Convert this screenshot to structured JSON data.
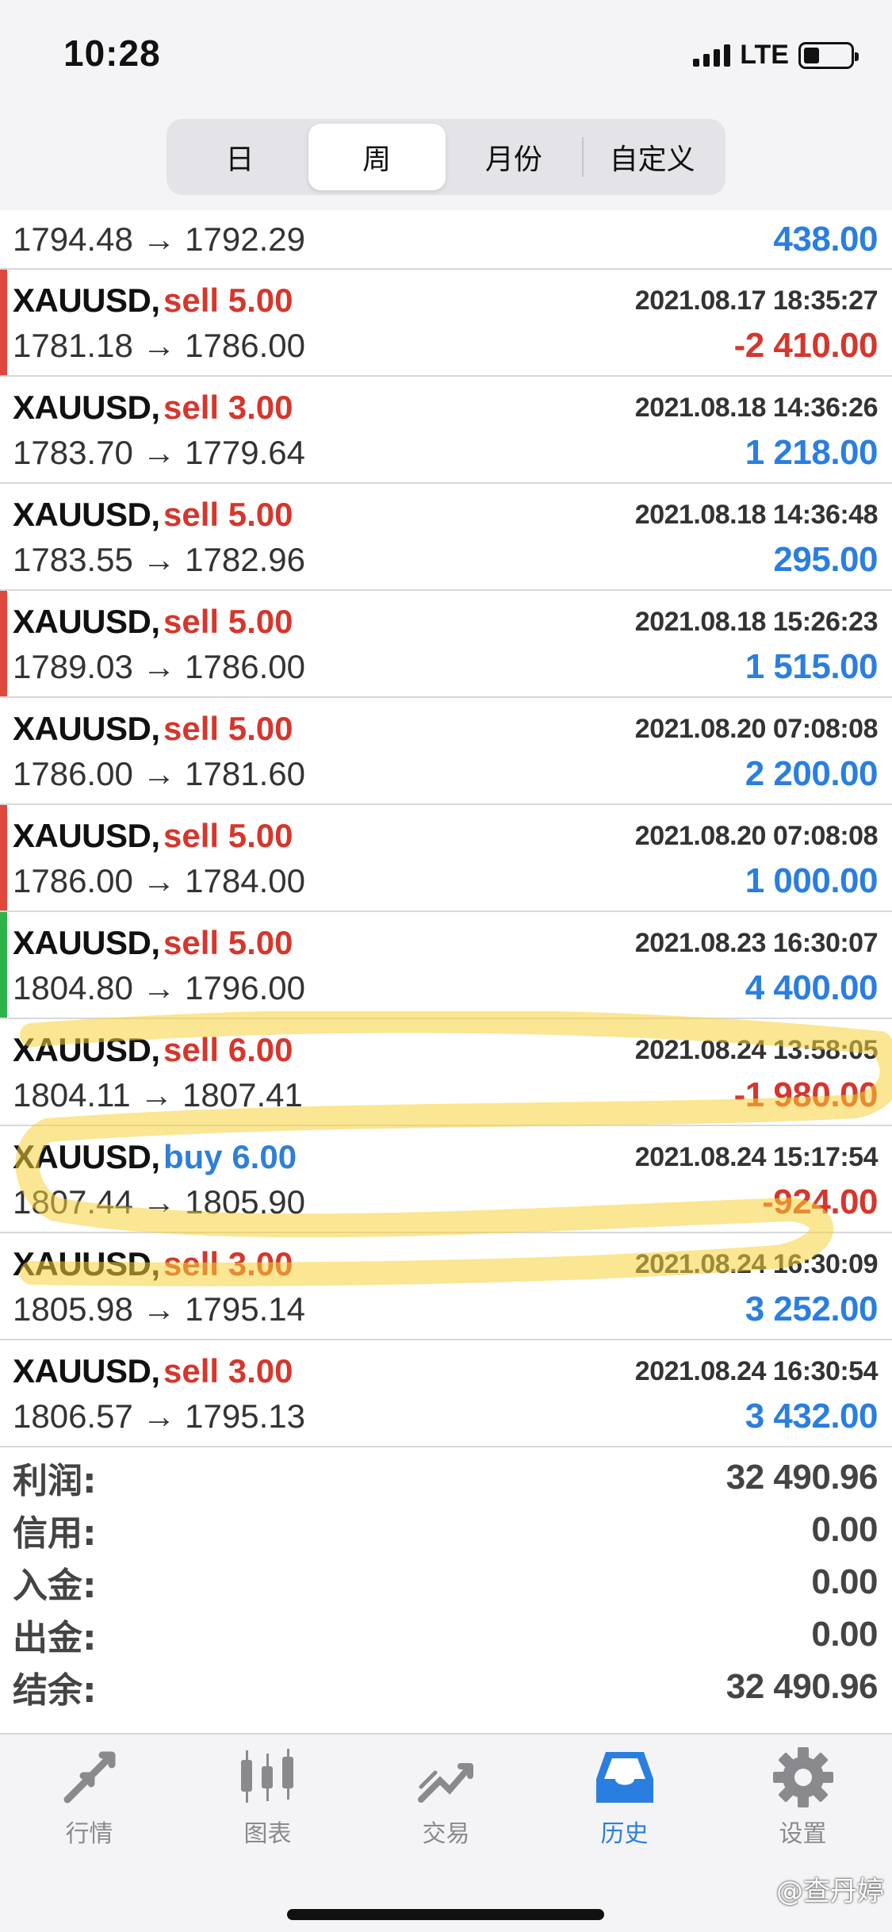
{
  "status": {
    "time": "10:28",
    "network": "LTE"
  },
  "segments": [
    {
      "label": "日"
    },
    {
      "label": "周"
    },
    {
      "label": "月份"
    },
    {
      "label": "自定义"
    }
  ],
  "partial_row": {
    "prices": "1794.48 → 1792.29",
    "profit": "438.00"
  },
  "trades": [
    {
      "symbol": "XAUUSD,",
      "side": "sell",
      "volume": "sell 5.00",
      "time": "2021.08.17 18:35:27",
      "prices": "1781.18 → 1786.00",
      "profit": "-2 410.00",
      "marker": "#e0483d"
    },
    {
      "symbol": "XAUUSD,",
      "side": "sell",
      "volume": "sell 3.00",
      "time": "2021.08.18 14:36:26",
      "prices": "1783.70 → 1779.64",
      "profit": "1 218.00",
      "marker": ""
    },
    {
      "symbol": "XAUUSD,",
      "side": "sell",
      "volume": "sell 5.00",
      "time": "2021.08.18 14:36:48",
      "prices": "1783.55 → 1782.96",
      "profit": "295.00",
      "marker": ""
    },
    {
      "symbol": "XAUUSD,",
      "side": "sell",
      "volume": "sell 5.00",
      "time": "2021.08.18 15:26:23",
      "prices": "1789.03 → 1786.00",
      "profit": "1 515.00",
      "marker": "#e0483d"
    },
    {
      "symbol": "XAUUSD,",
      "side": "sell",
      "volume": "sell 5.00",
      "time": "2021.08.20 07:08:08",
      "prices": "1786.00 → 1781.60",
      "profit": "2 200.00",
      "marker": ""
    },
    {
      "symbol": "XAUUSD,",
      "side": "sell",
      "volume": "sell 5.00",
      "time": "2021.08.20 07:08:08",
      "prices": "1786.00 → 1784.00",
      "profit": "1 000.00",
      "marker": "#e0483d"
    },
    {
      "symbol": "XAUUSD,",
      "side": "sell",
      "volume": "sell 5.00",
      "time": "2021.08.23 16:30:07",
      "prices": "1804.80 → 1796.00",
      "profit": "4 400.00",
      "marker": "#2cb34a"
    },
    {
      "symbol": "XAUUSD,",
      "side": "sell",
      "volume": "sell 6.00",
      "time": "2021.08.24 13:58:05",
      "prices": "1804.11 → 1807.41",
      "profit": "-1 980.00",
      "marker": ""
    },
    {
      "symbol": "XAUUSD,",
      "side": "buy",
      "volume": "buy 6.00",
      "time": "2021.08.24 15:17:54",
      "prices": "1807.44 → 1805.90",
      "profit": "-924.00",
      "marker": ""
    },
    {
      "symbol": "XAUUSD,",
      "side": "sell",
      "volume": "sell 3.00",
      "time": "2021.08.24 16:30:09",
      "prices": "1805.98 → 1795.14",
      "profit": "3 252.00",
      "marker": ""
    },
    {
      "symbol": "XAUUSD,",
      "side": "sell",
      "volume": "sell 3.00",
      "time": "2021.08.24 16:30:54",
      "prices": "1806.57 → 1795.13",
      "profit": "3 432.00",
      "marker": ""
    }
  ],
  "summary": [
    {
      "label": "利润:",
      "value": "32 490.96"
    },
    {
      "label": "信用:",
      "value": "0.00"
    },
    {
      "label": "入金:",
      "value": "0.00"
    },
    {
      "label": "出金:",
      "value": "0.00"
    },
    {
      "label": "结余:",
      "value": "32 490.96"
    }
  ],
  "tabs": [
    {
      "label": "行情",
      "icon": "quotes-arrows-icon"
    },
    {
      "label": "图表",
      "icon": "candlestick-chart-icon"
    },
    {
      "label": "交易",
      "icon": "trade-trend-icon"
    },
    {
      "label": "历史",
      "icon": "history-inbox-icon"
    },
    {
      "label": "设置",
      "icon": "gear-icon"
    }
  ],
  "watermark": "@查丹婷",
  "colors": {
    "sell": "#d6362c",
    "buy": "#2f7fd7",
    "positive": "#2a7ee0",
    "negative": "#d6362c",
    "active_tab": "#2a7ee0",
    "highlight": "#f5d23a"
  }
}
